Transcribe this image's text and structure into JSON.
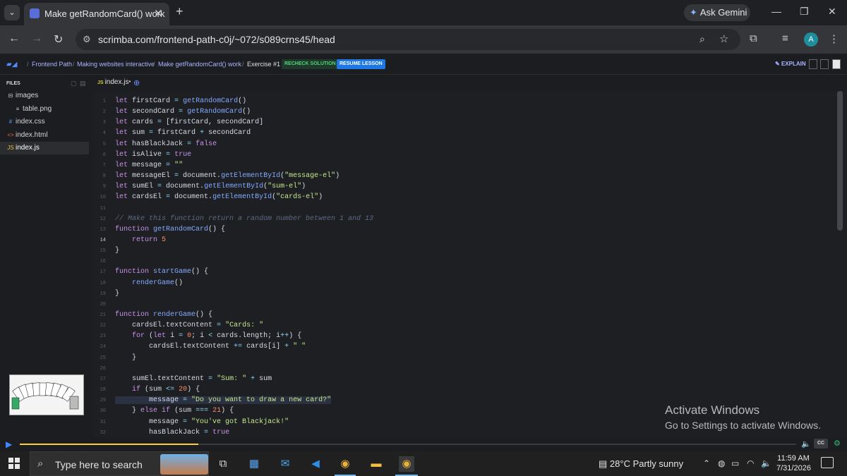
{
  "browser": {
    "tab_title": "Make getRandomCard() work",
    "close_glyph": "✕",
    "new_tab_glyph": "+",
    "ask_gemini": "Ask Gemini",
    "url": "scrimba.com/frontend-path-c0j/~072/s089crns45/head",
    "avatar_letter": "A"
  },
  "scrimba": {
    "breadcrumbs": [
      "Frontend Path",
      "Making websites interactive",
      "Make getRandomCard() work"
    ],
    "exercise": "Exercise #1",
    "recheck": "RECHECK SOLUTION",
    "resume": "RESUME LESSON",
    "explain": "EXPLAIN"
  },
  "sidebar": {
    "header": "FILES",
    "files": [
      {
        "name": "images",
        "icon": "folder-icon",
        "glyph": "⊟",
        "indent": 0,
        "active": false
      },
      {
        "name": "table.png",
        "icon": "image-file-icon",
        "glyph": "≡",
        "indent": 1,
        "active": false
      },
      {
        "name": "index.css",
        "icon": "css-file-icon",
        "glyph": "#",
        "indent": 0,
        "active": false
      },
      {
        "name": "index.html",
        "icon": "html-file-icon",
        "glyph": "<>",
        "indent": 0,
        "active": false
      },
      {
        "name": "index.js",
        "icon": "js-file-icon",
        "glyph": "JS",
        "indent": 0,
        "active": true
      }
    ]
  },
  "editor": {
    "tab_name": "index.js",
    "tab_modified": "•",
    "tab_lang": "JS",
    "current_line": 14,
    "highlighted_line": 29,
    "lines": [
      "let firstCard = getRandomCard()",
      "let secondCard = getRandomCard()",
      "let cards = [firstCard, secondCard]",
      "let sum = firstCard + secondCard",
      "let hasBlackJack = false",
      "let isAlive = true",
      "let message = \"\"",
      "let messageEl = document.getElementById(\"message-el\")",
      "let sumEl = document.getElementById(\"sum-el\")",
      "let cardsEl = document.getElementById(\"cards-el\")",
      "",
      "// Make this function return a random number between 1 and 13",
      "function getRandomCard() {",
      "    return 5",
      "}",
      "",
      "function startGame() {",
      "    renderGame()",
      "}",
      "",
      "function renderGame() {",
      "    cardsEl.textContent = \"Cards: \"",
      "    for (let i = 0; i < cards.length; i++) {",
      "        cardsEl.textContent += cards[i] + \" \"",
      "    }",
      "",
      "    sumEl.textContent = \"Sum: \" + sum",
      "    if (sum <= 20) {",
      "        message = \"Do you want to draw a new card?\"",
      "    } else if (sum === 21) {",
      "        message = \"You've got Blackjack!\"",
      "        hasBlackJack = true"
    ]
  },
  "watermark": {
    "title": "Activate Windows",
    "subtitle": "Go to Settings to activate Windows."
  },
  "player": {
    "progress_fraction": 0.23,
    "cc": "CC"
  },
  "taskbar": {
    "search_placeholder": "Type here to search",
    "weather": "28°C  Partly sunny",
    "time": "11:59 AM",
    "date": "7/31/2026"
  }
}
